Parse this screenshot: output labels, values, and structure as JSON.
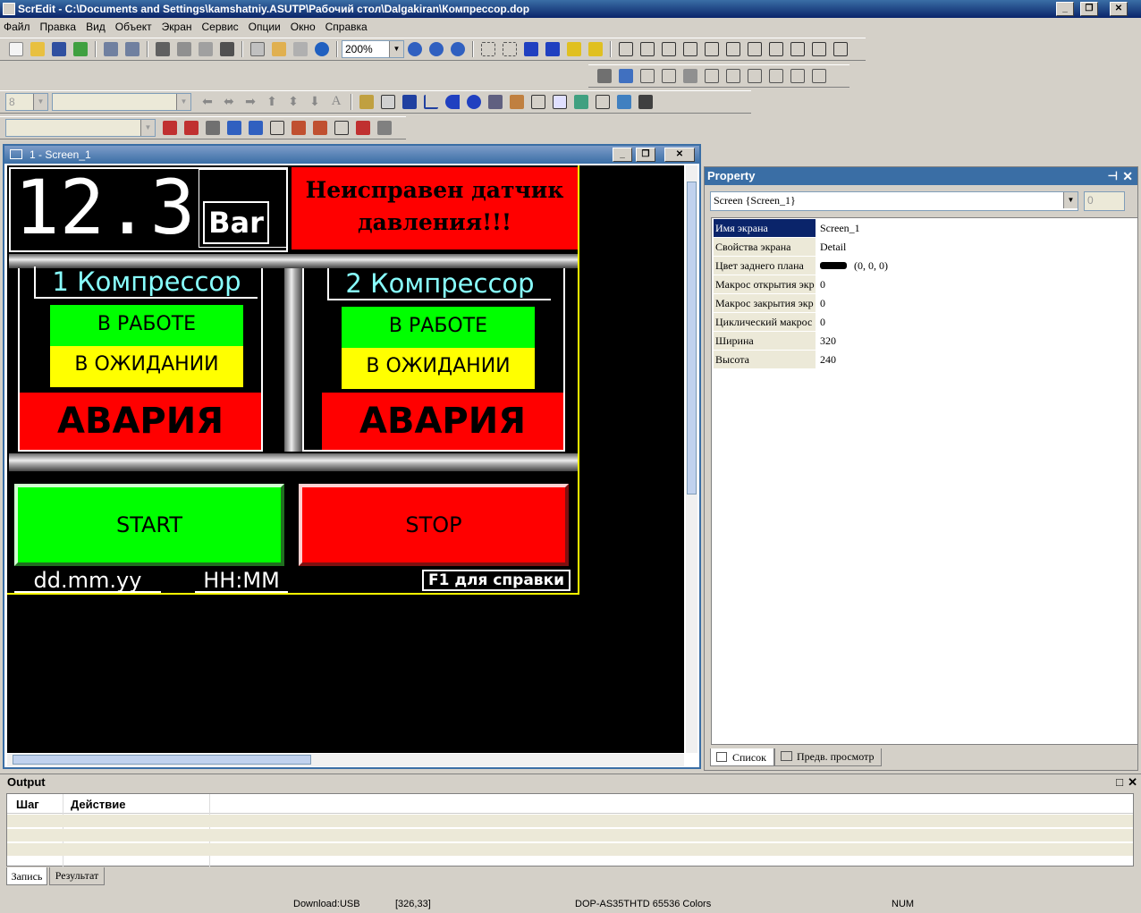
{
  "window": {
    "title": "ScrEdit - C:\\Documents and Settings\\kamshatniy.ASUTP\\Рабочий стол\\Dalgakiran\\Компрессор.dop"
  },
  "menu": [
    "Файл",
    "Правка",
    "Вид",
    "Объект",
    "Экран",
    "Сервис",
    "Опции",
    "Окно",
    "Справка"
  ],
  "toolbar": {
    "zoom": "200%",
    "font_size": "8",
    "text_tool": "A"
  },
  "colors": {
    "titlebar": "#0a246a",
    "hmi_green": "#00ff00",
    "hmi_yellow": "#ffff00",
    "hmi_red": "#ff0000",
    "hmi_cyan": "#88ffff",
    "selection": "#0a246a"
  },
  "child": {
    "title": "1 - Screen_1"
  },
  "hmi": {
    "pressure_value": "12.3",
    "pressure_unit": "Bar",
    "alarm": "Неисправен датчик давления!!!",
    "comp1": {
      "title": "1 Компрессор",
      "running": "В РАБОТЕ",
      "waiting": "В ОЖИДАНИИ",
      "fault": "АВАРИЯ"
    },
    "comp2": {
      "title": "2 Компрессор",
      "running": "В РАБОТЕ",
      "waiting": "В ОЖИДАНИИ",
      "fault": "АВАРИЯ"
    },
    "start": "START",
    "stop": "STOP",
    "date": "dd.mm.yy",
    "time": "HH:MM",
    "help": "F1 для справки"
  },
  "property": {
    "title": "Property",
    "object": "Screen {Screen_1}",
    "spin": "0",
    "rows": [
      {
        "name": "Имя экрана",
        "value": "Screen_1"
      },
      {
        "name": "Свойства экрана",
        "value": "Detail"
      },
      {
        "name": "Цвет заднего плана",
        "value": "(0, 0, 0)"
      },
      {
        "name": "Макрос открытия экр",
        "value": "0"
      },
      {
        "name": "Макрос закрытия экр",
        "value": "0"
      },
      {
        "name": "Циклический макрос :",
        "value": "0"
      },
      {
        "name": "Ширина",
        "value": "320"
      },
      {
        "name": "Высота",
        "value": "240"
      }
    ],
    "tabs": [
      "Список",
      "Предв. просмотр"
    ]
  },
  "output": {
    "title": "Output",
    "columns": [
      "Шаг",
      "Действие"
    ],
    "tabs": [
      "Запись",
      "Результат"
    ]
  },
  "status": {
    "download": "Download:USB",
    "coords": "[326,33]",
    "device": "DOP-AS35THTD 65536 Colors",
    "num": "NUM"
  }
}
